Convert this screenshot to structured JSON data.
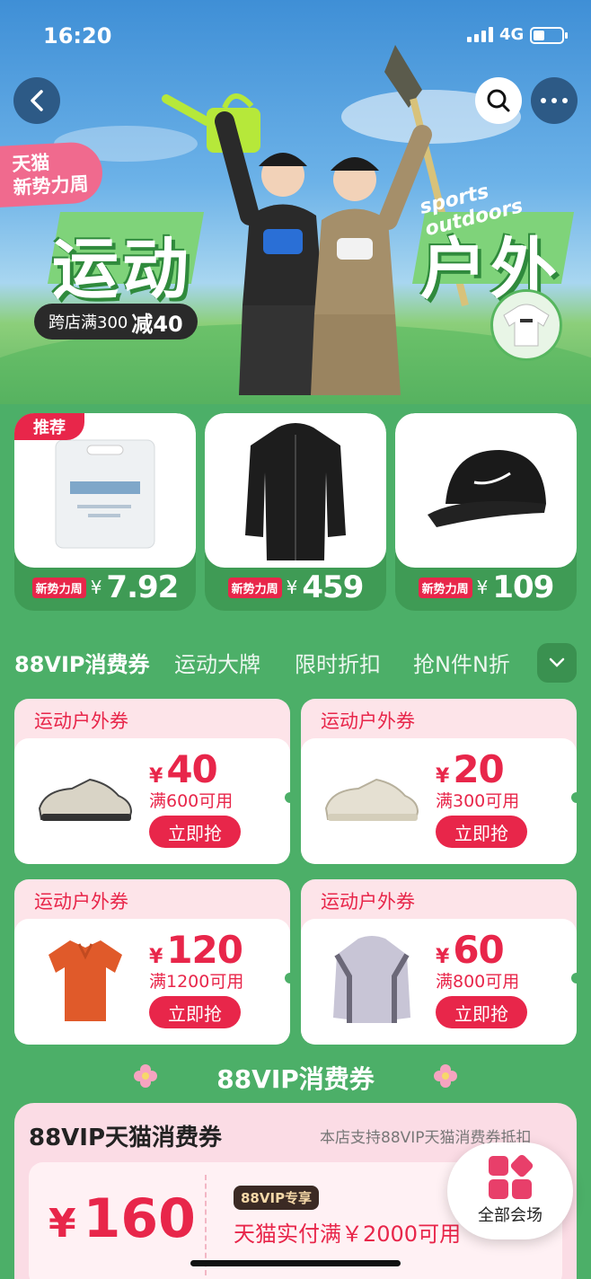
{
  "status_bar": {
    "time": "16:20",
    "network": "4G"
  },
  "hero": {
    "event_tag_line1": "天猫",
    "event_tag_line2": "新势力周",
    "title_left": "运动",
    "title_right": "户外",
    "sports_text": "sports outdoors",
    "discount_prefix": "跨店满300",
    "discount_amount": "减40"
  },
  "products": [
    {
      "badge": "新势力周",
      "currency": "¥",
      "price": "7.92",
      "recommend": "推荐",
      "image": "compressed-towel-pack"
    },
    {
      "badge": "新势力周",
      "currency": "¥",
      "price": "459",
      "image": "black-jacket"
    },
    {
      "badge": "新势力周",
      "currency": "¥",
      "price": "109",
      "image": "black-cap"
    }
  ],
  "tabs": [
    "88VIP消费券",
    "运动大牌",
    "限时折扣",
    "抢N件N折"
  ],
  "coupons": [
    {
      "title": "运动户外券",
      "currency": "¥",
      "amount": "40",
      "condition": "满600可用",
      "button": "立即抢",
      "image": "running-shoe"
    },
    {
      "title": "运动户外券",
      "currency": "¥",
      "amount": "20",
      "condition": "满300可用",
      "button": "立即抢",
      "image": "beige-sneaker"
    },
    {
      "title": "运动户外券",
      "currency": "¥",
      "amount": "120",
      "condition": "满1200可用",
      "button": "立即抢",
      "image": "orange-polo"
    },
    {
      "title": "运动户外券",
      "currency": "¥",
      "amount": "60",
      "condition": "满800可用",
      "button": "立即抢",
      "image": "grey-jacket"
    }
  ],
  "vip_section": {
    "title": "88VIP消费券",
    "card_name": "88VIP天猫消费券",
    "card_note": "本店支持88VIP天猫消费券抵扣",
    "currency": "¥",
    "amount": "160",
    "badge": "88VIP专享",
    "condition": "天猫实付满￥2000可用"
  },
  "fab": {
    "label": "全部会场"
  },
  "colors": {
    "primary_green": "#4caf68",
    "accent_red": "#e8264a",
    "pink": "#fde4e9"
  }
}
